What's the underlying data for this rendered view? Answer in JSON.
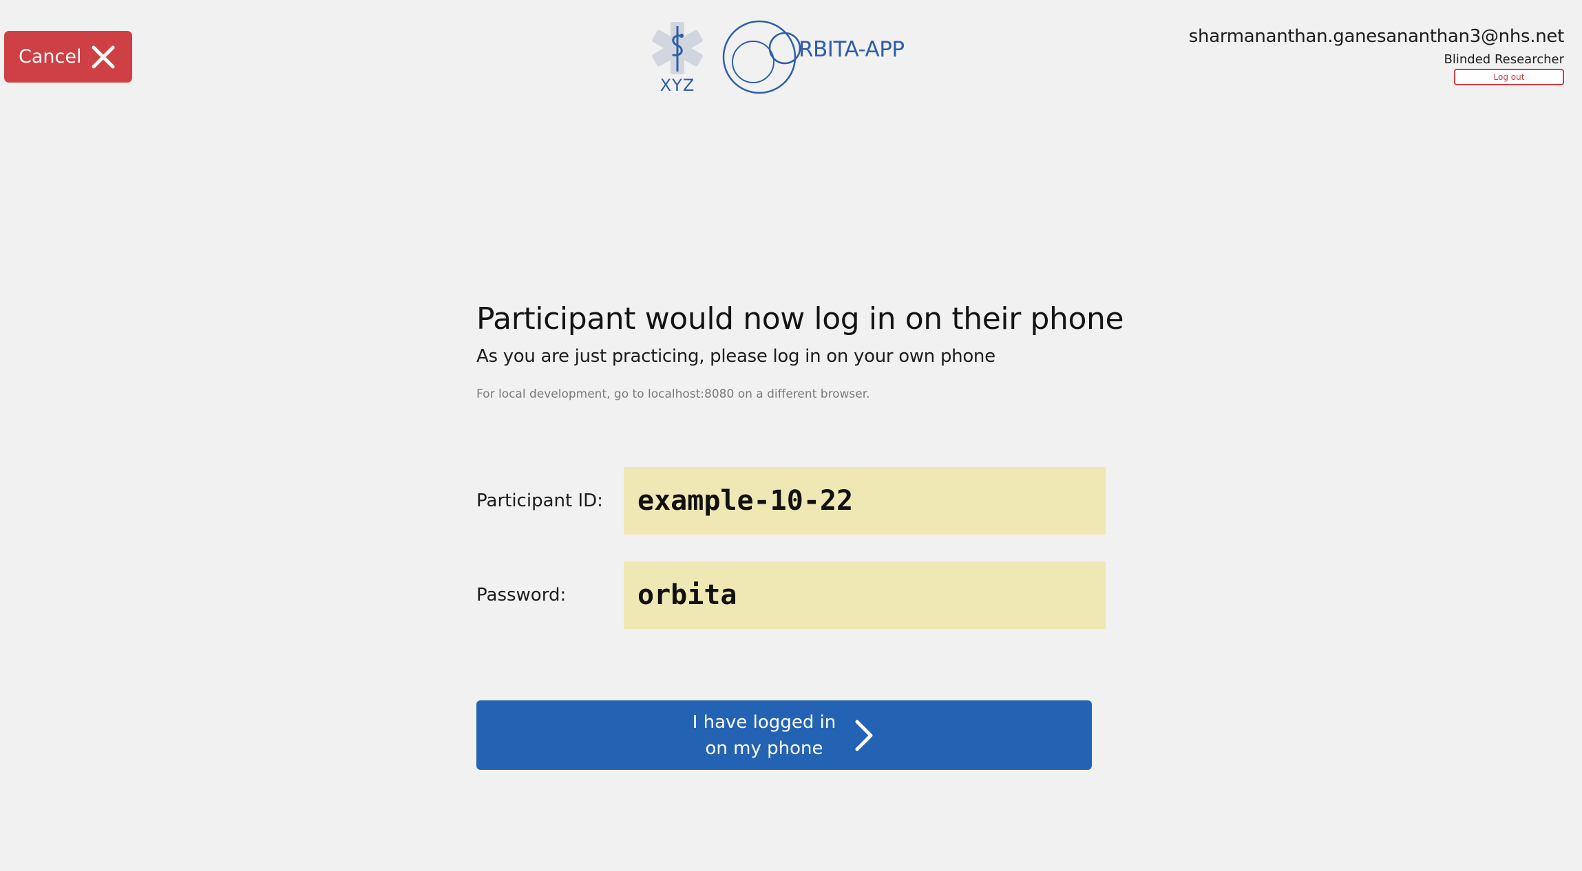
{
  "header": {
    "cancel_label": "Cancel",
    "xyz_logo_text": "XYZ",
    "orbita_logo_text": "RBITA-APP",
    "user": {
      "email": "sharmananthan.ganesananthan3@nhs.net",
      "role": "Blinded Researcher",
      "logout_label": "Log out"
    }
  },
  "main": {
    "title": "Participant would now log in on their phone",
    "subtitle": "As you are just practicing, please log in on your own phone",
    "dev_note": "For local development, go to localhost:8080 on a different browser.",
    "participant_id": {
      "label": "Participant ID:",
      "value": "example-10-22"
    },
    "password": {
      "label": "Password:",
      "value": "orbita"
    },
    "confirm_button": {
      "line1": "I have logged in",
      "line2": "on my phone"
    }
  },
  "colors": {
    "background": "#f1f1f1",
    "cancel_red": "#cf4044",
    "primary_blue": "#2463b4",
    "logo_blue": "#2e5fa8",
    "credential_bg": "#efe8b4"
  },
  "icons": {
    "cancel": "close-icon",
    "confirm": "chevron-right-icon",
    "logo_left": "star-of-life-icon",
    "logo_right": "orbit-circles-icon"
  }
}
